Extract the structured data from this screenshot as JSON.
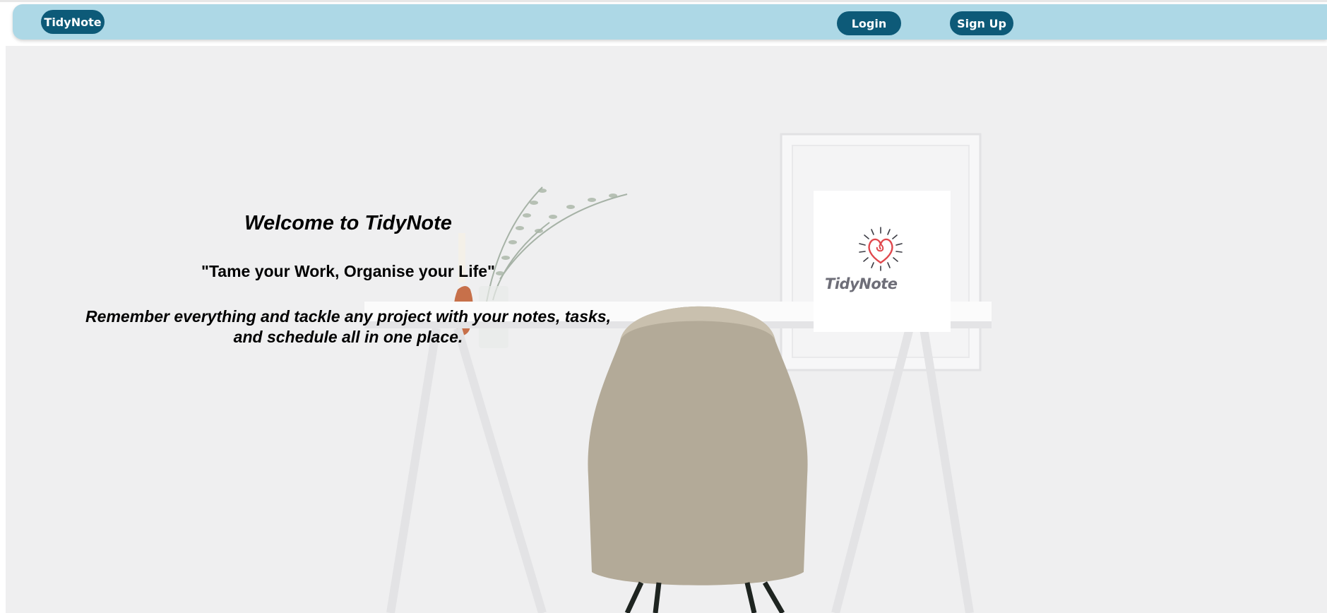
{
  "navbar": {
    "brand_label": "TidyNote",
    "login_label": "Login",
    "signup_label": "Sign Up"
  },
  "hero": {
    "title": "Welcome to TidyNote",
    "quote": "\"Tame your Work, Organise your Life\"",
    "description": "Remember everything and tackle any project with your notes, tasks, and schedule all in one place."
  },
  "logo": {
    "text": "TidyNote",
    "icon": "heart-burst-icon"
  },
  "colors": {
    "navbar_bg": "#add8e6",
    "pill_bg": "#0d5a78",
    "pill_text": "#ffffff",
    "heart": "#e0474c"
  }
}
